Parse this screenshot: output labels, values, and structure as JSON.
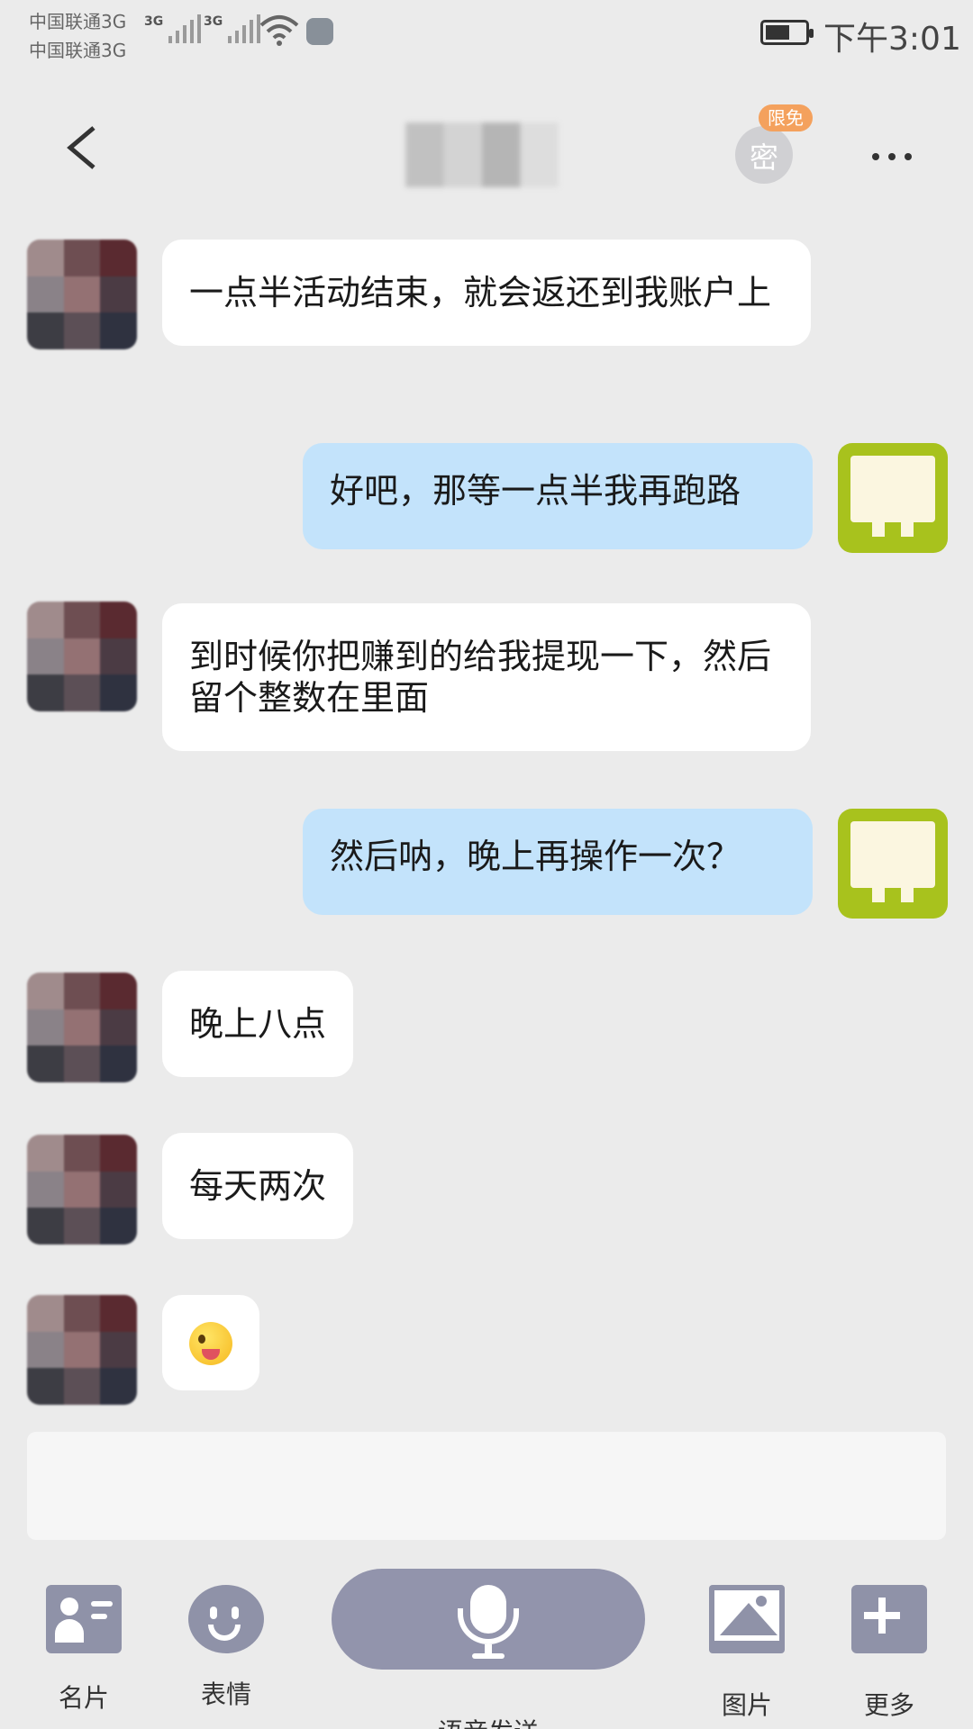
{
  "status_bar": {
    "carrier_1": "中国联通3G",
    "carrier_2": "中国联通3G",
    "network_1": "3G",
    "network_2": "3G",
    "time": "下午3:01",
    "icons": [
      "signal-icon",
      "signal-icon",
      "wifi-icon",
      "app-notification-icon",
      "battery-icon"
    ]
  },
  "header": {
    "title": "",
    "secret_button_char": "密",
    "secret_badge": "限免",
    "icons": [
      "back-arrow-icon",
      "more-dots-icon"
    ]
  },
  "messages": [
    {
      "side": "in",
      "text": "一点半活动结束，就会返还到我账户上"
    },
    {
      "side": "out",
      "text": "好吧，那等一点半我再跑路"
    },
    {
      "side": "in",
      "text": "到时候你把赚到的给我提现一下，然后留个整数在里面"
    },
    {
      "side": "out",
      "text": "然后呐，晚上再操作一次？"
    },
    {
      "side": "in",
      "text": "晚上八点"
    },
    {
      "side": "in",
      "text": "每天两次"
    },
    {
      "side": "in",
      "text": "",
      "emoji": "winking-tongue-emoji"
    }
  ],
  "input": {
    "value": "",
    "placeholder": ""
  },
  "toolbar": {
    "card_label": "名片",
    "emoji_label": "表情",
    "voice_label": "语音发送",
    "image_label": "图片",
    "more_label": "更多"
  },
  "colors": {
    "background": "#ebebeb",
    "incoming_bubble": "#ffffff",
    "outgoing_bubble": "#c3e3fb",
    "toolbar_icon": "#8f92a8",
    "badge": "#f4a15d",
    "self_avatar": "#a8c21d"
  }
}
